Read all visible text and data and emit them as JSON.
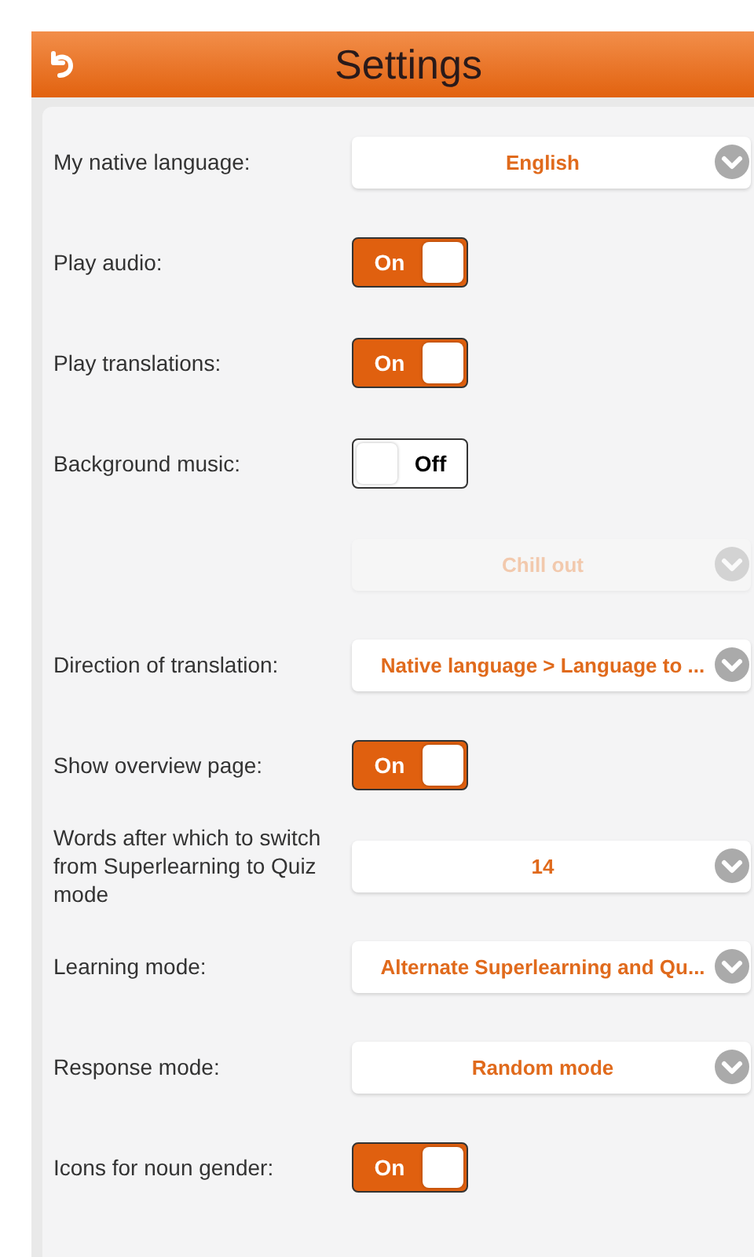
{
  "header": {
    "title": "Settings"
  },
  "settings": [
    {
      "kind": "select",
      "label": "My native language:",
      "value": "English",
      "disabled": false
    },
    {
      "kind": "toggle",
      "label": "Play audio:",
      "on": true,
      "text": "On"
    },
    {
      "kind": "toggle",
      "label": "Play translations:",
      "on": true,
      "text": "On"
    },
    {
      "kind": "toggle",
      "label": "Background music:",
      "on": false,
      "text": "Off"
    },
    {
      "kind": "select",
      "value": "Chill out",
      "disabled": true
    },
    {
      "kind": "select",
      "label": "Direction of translation:",
      "value": "Native language > Language to ...",
      "disabled": false
    },
    {
      "kind": "toggle",
      "label": "Show overview page:",
      "on": true,
      "text": "On"
    },
    {
      "kind": "select",
      "label": "Words after which to switch from Superlearning to Quiz mode",
      "value": "14",
      "disabled": false
    },
    {
      "kind": "select",
      "label": "Learning mode:",
      "value": "Alternate Superlearning and Qu...",
      "disabled": false
    },
    {
      "kind": "select",
      "label": "Response mode:",
      "value": "Random mode",
      "disabled": false
    },
    {
      "kind": "toggle",
      "label": "Icons for noun gender:",
      "on": true,
      "text": "On"
    }
  ]
}
